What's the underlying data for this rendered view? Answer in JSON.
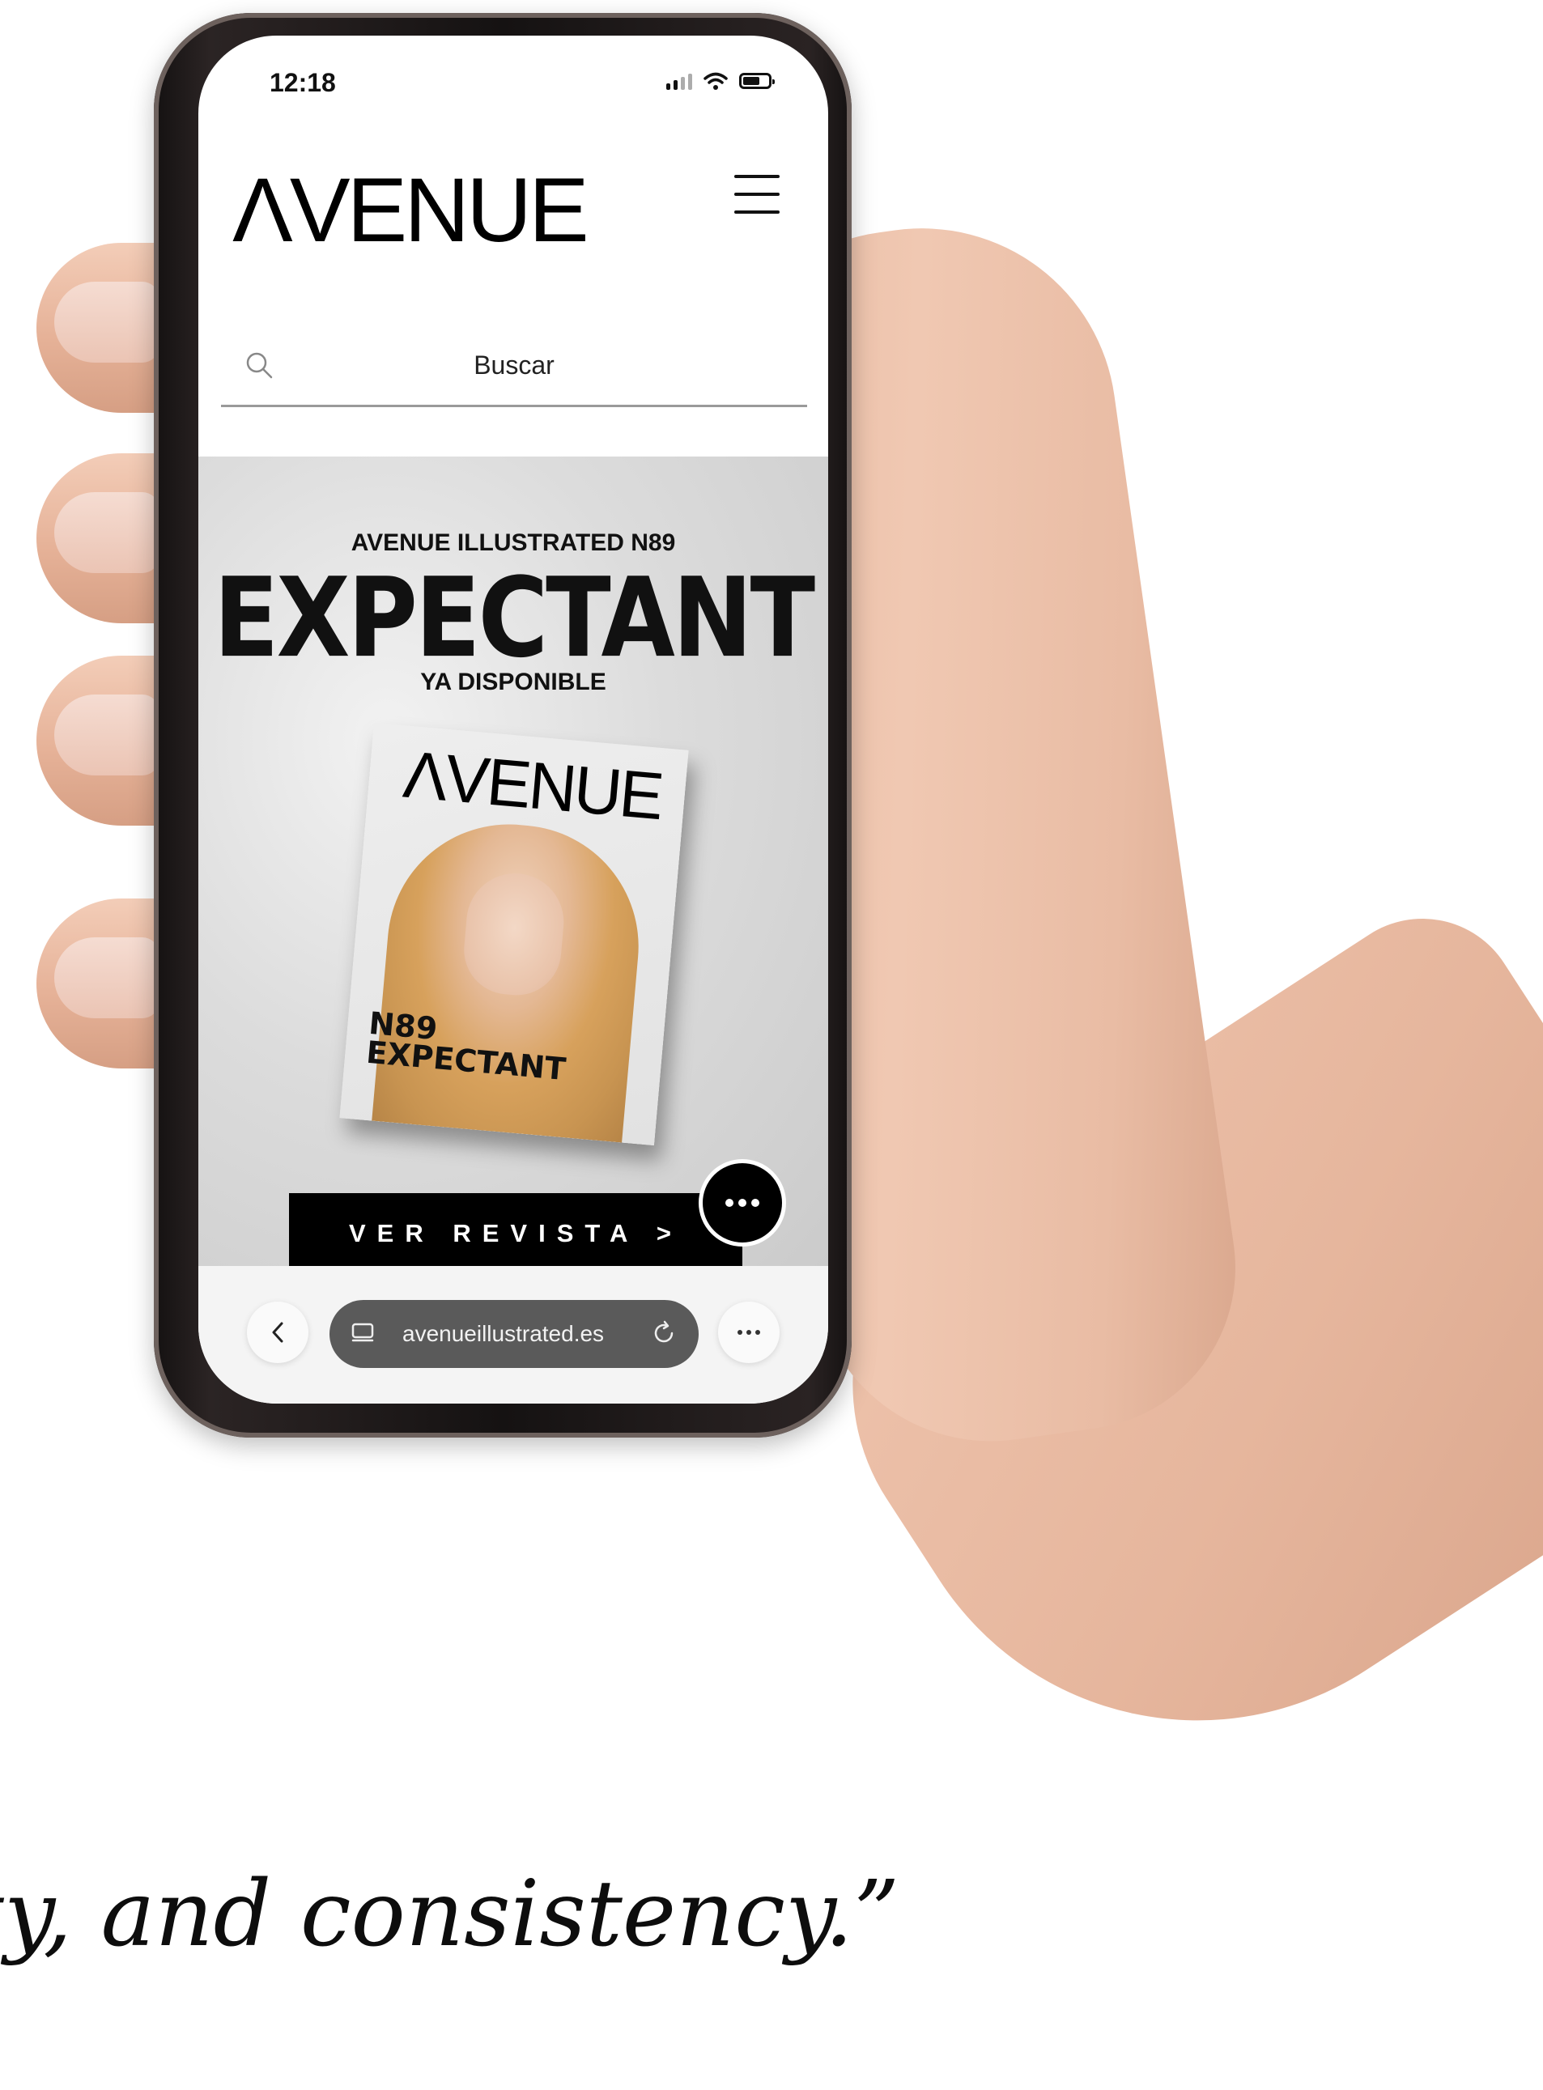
{
  "status_bar": {
    "time": "12:18",
    "icons": [
      "signal-icon",
      "wifi-icon",
      "battery-icon"
    ]
  },
  "header": {
    "logo": "ΛVENUE",
    "menu_icon": "hamburger-menu-icon"
  },
  "search": {
    "placeholder": "Buscar",
    "icon": "search-icon"
  },
  "hero": {
    "kicker": "AVENUE ILLUSTRATED N89",
    "title": "EXPECTANT",
    "subtitle": "YA DISPONIBLE",
    "cover": {
      "logo": "ΛVENUE",
      "issue": "N89",
      "issue_title": "EXPECTANT"
    },
    "cta_label": "VER REVISTA >",
    "fab_icon": "more-dots-icon"
  },
  "browser": {
    "url": "avenueillustrated.es",
    "back_icon": "chevron-left-icon",
    "tabs_icon": "tabs-icon",
    "reload_icon": "reload-icon",
    "more_icon": "more-dots-icon"
  },
  "quote": {
    "text": "ty, and consistency.”"
  },
  "colors": {
    "brand": "#000000",
    "hero_bg": "#d8d8d8",
    "url_pill": "#5a5a5a",
    "skin": "#e9bca4"
  }
}
